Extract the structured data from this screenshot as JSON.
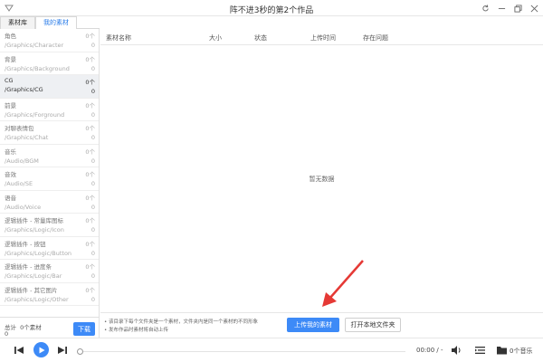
{
  "window": {
    "title": "阵不进3秒的第2个作品"
  },
  "tabs": [
    {
      "label": "素材库"
    },
    {
      "label": "我的素材"
    }
  ],
  "categories": [
    {
      "name": "角色",
      "path": "/Graphics/Character",
      "count_label": "0个",
      "count": "0"
    },
    {
      "name": "背景",
      "path": "/Graphics/Background",
      "count_label": "0个",
      "count": "0"
    },
    {
      "name": "CG",
      "path": "/Graphics/CG",
      "count_label": "0个",
      "count": "0"
    },
    {
      "name": "前景",
      "path": "/Graphics/Forground",
      "count_label": "0个",
      "count": "0"
    },
    {
      "name": "对聊表情包",
      "path": "/Graphics/Chat",
      "count_label": "0个",
      "count": "0"
    },
    {
      "name": "音乐",
      "path": "/Audio/BGM",
      "count_label": "0个",
      "count": "0"
    },
    {
      "name": "音效",
      "path": "/Audio/SE",
      "count_label": "0个",
      "count": "0"
    },
    {
      "name": "语音",
      "path": "/Audio/Voice",
      "count_label": "0个",
      "count": "0"
    },
    {
      "name": "逻辑插件 - 常量库图标",
      "path": "/Graphics/Logic/Icon",
      "count_label": "0个",
      "count": "0"
    },
    {
      "name": "逻辑插件 - 按钮",
      "path": "/Graphics/Logic/Button",
      "count_label": "0个",
      "count": "0"
    },
    {
      "name": "逻辑插件 - 进度条",
      "path": "/Graphics/Logic/Bar",
      "count_label": "0个",
      "count": "0"
    },
    {
      "name": "逻辑插件 - 其它图片",
      "path": "/Graphics/Logic/Other",
      "count_label": "0个",
      "count": "0"
    }
  ],
  "sidebar_footer": {
    "total_label": "总计",
    "total_count": "0个素材",
    "total_value": "0",
    "download_label": "下载"
  },
  "table": {
    "columns": [
      "素材名称",
      "大小",
      "状态",
      "上传时间",
      "存在问题"
    ],
    "empty_text": "暂无数据"
  },
  "actions": {
    "tip1": "• 该目录下每个文件夹是一个素材，文件夹内是同一个素材的不同形象",
    "tip2": "• 发布作品时素材将自动上传",
    "upload_label": "上传我的素材",
    "open_folder_label": "打开本地文件夹"
  },
  "player": {
    "time": "00:00 / -",
    "music_count": "0个音乐",
    "progress": 0
  },
  "colors": {
    "accent": "#3d8af7",
    "arrow": "#e53935"
  }
}
